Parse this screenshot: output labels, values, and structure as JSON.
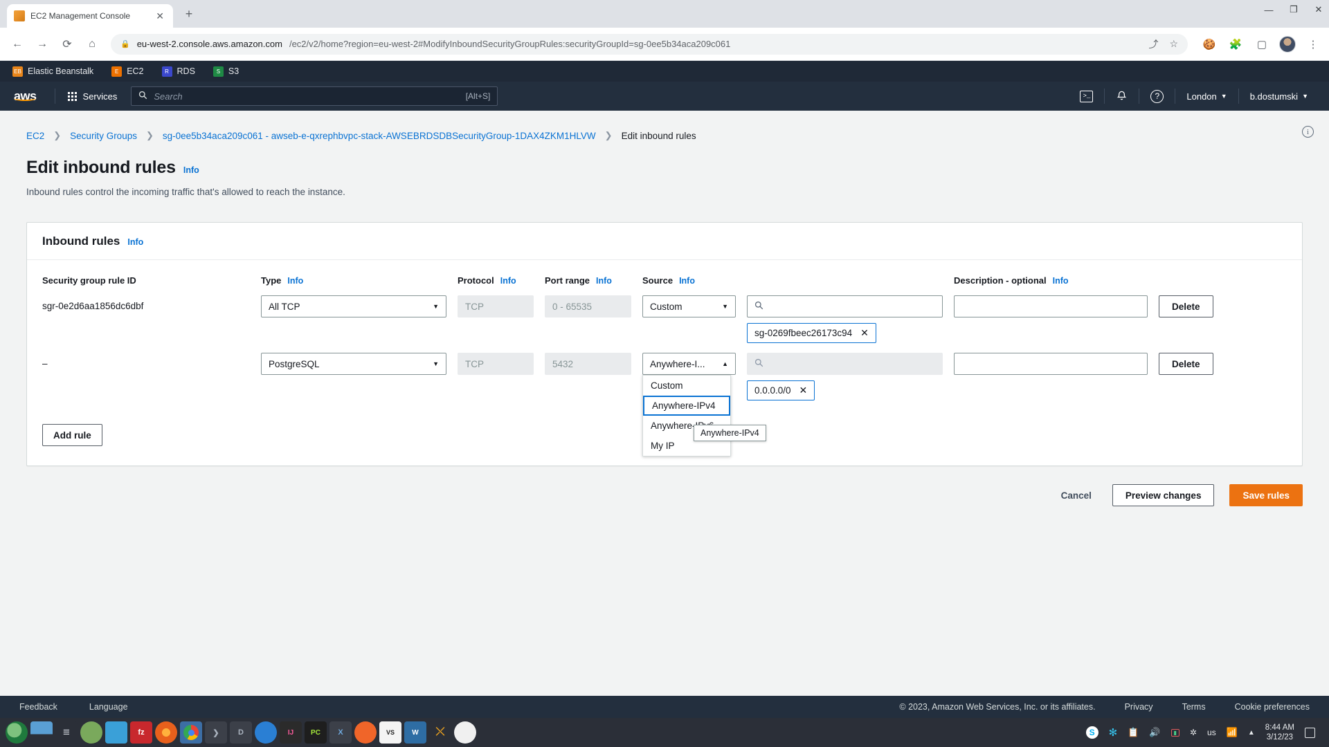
{
  "browser": {
    "tab": {
      "title": "EC2 Management Console",
      "favicon": "aws-cube-icon",
      "close": "✕"
    },
    "newtab": "+",
    "window_controls": {
      "minimize": "—",
      "maximize": "❐",
      "close": "✕"
    },
    "nav": {
      "back": "←",
      "forward": "→",
      "reload": "⟳",
      "home": "⌂"
    },
    "url": {
      "lock": "🔒",
      "domain": "eu-west-2.console.aws.amazon.com",
      "path": "/ec2/v2/home?region=eu-west-2#ModifyInboundSecurityGroupRules:securityGroupId=sg-0ee5b34aca209c061"
    },
    "omnibox_actions": {
      "share": "⤴",
      "bookmark": "☆"
    },
    "toolbar_right": {
      "cookie": "🍪",
      "extensions": "🧩",
      "sidepanel": "▢",
      "menu": "⋮"
    }
  },
  "bookmarks": [
    {
      "label": "Elastic Beanstalk",
      "icon": "elastic-beanstalk-icon",
      "glyph": "EB",
      "class": "ico-eb"
    },
    {
      "label": "EC2",
      "icon": "ec2-icon",
      "glyph": "E",
      "class": "ico-ec2"
    },
    {
      "label": "RDS",
      "icon": "rds-icon",
      "glyph": "R",
      "class": "ico-rds"
    },
    {
      "label": "S3",
      "icon": "s3-icon",
      "glyph": "S",
      "class": "ico-s3"
    }
  ],
  "aws_header": {
    "logo": "aws",
    "services_label": "Services",
    "search": {
      "placeholder": "Search",
      "value": "Search",
      "shortcut": "[Alt+S]"
    },
    "cloudshell_icon": ">_",
    "notifications_icon": "bell-icon",
    "help_icon": "?",
    "region": "London",
    "account": "b.dostumski",
    "caret": "▼"
  },
  "breadcrumb": {
    "items": [
      {
        "label": "EC2",
        "current": false
      },
      {
        "label": "Security Groups",
        "current": false
      },
      {
        "label": "sg-0ee5b34aca209c061 - awseb-e-qxrephbvpc-stack-AWSEBRDSDBSecurityGroup-1DAX4ZKM1HLVW",
        "current": false
      },
      {
        "label": "Edit inbound rules",
        "current": true
      }
    ],
    "separator": "❯"
  },
  "page": {
    "title": "Edit inbound rules",
    "info": "Info",
    "subtitle": "Inbound rules control the incoming traffic that's allowed to reach the instance.",
    "corner_info_icon": "i"
  },
  "panel": {
    "title": "Inbound rules",
    "info": "Info",
    "columns": [
      {
        "label": "Security group rule ID",
        "info": null
      },
      {
        "label": "Type",
        "info": "Info"
      },
      {
        "label": "Protocol",
        "info": "Info"
      },
      {
        "label": "Port range",
        "info": "Info"
      },
      {
        "label": "Source",
        "info": "Info"
      },
      {
        "label": "Description - optional",
        "info": "Info"
      }
    ],
    "rows": [
      {
        "rule_id": "sgr-0e2d6aa1856dc6dbf",
        "type": "All TCP",
        "protocol": "TCP",
        "port_range": "0 - 65535",
        "source_type": "Custom",
        "source_search_placeholder": "",
        "source_token": "sg-0269fbeec26173c94",
        "token_remove": "✕",
        "description": "",
        "delete_label": "Delete"
      },
      {
        "rule_id": "–",
        "type": "PostgreSQL",
        "protocol": "TCP",
        "port_range": "5432",
        "source_type": "Anywhere-I...",
        "source_search_placeholder": "",
        "source_token": "0.0.0.0/0",
        "token_remove": "✕",
        "description": "",
        "delete_label": "Delete"
      }
    ],
    "source_dropdown": {
      "open": true,
      "options": [
        "Custom",
        "Anywhere-IPv4",
        "Anywhere-IPv6",
        "My IP"
      ],
      "selected": "Anywhere-IPv4",
      "tooltip": "Anywhere-IPv4"
    },
    "add_rule_label": "Add rule"
  },
  "actions": {
    "cancel": "Cancel",
    "preview": "Preview changes",
    "save": "Save rules"
  },
  "aws_footer": {
    "feedback": "Feedback",
    "language": "Language",
    "copyright": "© 2023, Amazon Web Services, Inc. or its affiliates.",
    "privacy": "Privacy",
    "terms": "Terms",
    "cookies": "Cookie preferences"
  },
  "taskbar": {
    "apps": [
      {
        "name": "opensuse-icon",
        "glyph": "",
        "color": "#2d8a44"
      },
      {
        "name": "window-icon",
        "glyph": "",
        "color": "#5a9fd4"
      },
      {
        "name": "settings-icon",
        "glyph": "",
        "color": "#4a5560"
      },
      {
        "name": "gimp-icon",
        "glyph": "",
        "color": "#6a9c5a"
      },
      {
        "name": "file-manager-icon",
        "glyph": "",
        "color": "#3aa0d8"
      },
      {
        "name": "filezilla-icon",
        "glyph": "",
        "color": "#c8282d"
      },
      {
        "name": "firefox-icon",
        "glyph": "",
        "color": "#e8601c"
      },
      {
        "name": "chrome-icon",
        "glyph": "",
        "color": "#4285f4",
        "active": true
      },
      {
        "name": "terminal-icon",
        "glyph": "❯",
        "color": "#3c4049"
      },
      {
        "name": "document-icon",
        "glyph": "D",
        "color": "#3c4049"
      },
      {
        "name": "kde-icon",
        "glyph": "",
        "color": "#2a7fd4"
      },
      {
        "name": "intellij-icon",
        "glyph": "IJ",
        "color": "#2b2b2b"
      },
      {
        "name": "pycharm-icon",
        "glyph": "PC",
        "color": "#1e1e1e"
      },
      {
        "name": "excel-icon",
        "glyph": "X",
        "color": "#3c4049"
      },
      {
        "name": "postman-icon",
        "glyph": "",
        "color": "#f06529"
      },
      {
        "name": "vs-icon",
        "glyph": "VS",
        "color": "#f4f4f4"
      },
      {
        "name": "workbench-icon",
        "glyph": "W",
        "color": "#2e6da4"
      },
      {
        "name": "gitkraken-icon",
        "glyph": "",
        "color": "#e8a020"
      },
      {
        "name": "slack-icon",
        "glyph": "",
        "color": "#f0f0f0"
      }
    ],
    "tray": {
      "skype": "S",
      "slack": "slack-icon",
      "clipboard": "clipboard-icon",
      "volume": "volume-icon",
      "battery": "battery-icon",
      "bluetooth": "bluetooth-icon",
      "keyboard_layout": "us",
      "wifi": "wifi-icon",
      "expand": "▲",
      "time": "8:44 AM",
      "date": "3/12/23",
      "show_desktop": "show-desktop-icon"
    }
  },
  "colors": {
    "aws_navy": "#232f3e",
    "aws_orange": "#ec7211",
    "link_blue": "#0972d3",
    "page_bg": "#f2f3f3"
  }
}
